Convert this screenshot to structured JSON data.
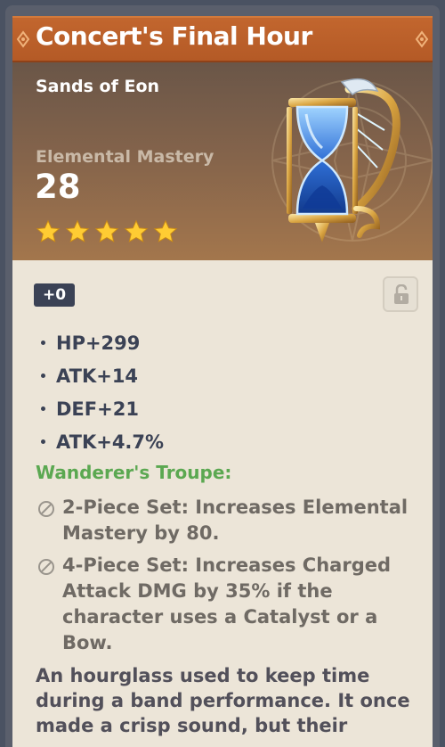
{
  "artifact": {
    "name": "Concert's Final Hour",
    "slot": "Sands of Eon",
    "main_stat": {
      "name": "Elemental Mastery",
      "value": "28"
    },
    "rarity": 5,
    "level": "+0",
    "locked": false,
    "substats": [
      "HP+299",
      "ATK+14",
      "DEF+21",
      "ATK+4.7%"
    ],
    "set": {
      "name": "Wanderer's Troupe:",
      "effects": [
        "2-Piece Set: Increases Elemental Mastery by 80.",
        "4-Piece Set: Increases Charged Attack DMG by 35% if the character uses a Catalyst or a Bow."
      ]
    },
    "description": "An hourglass used to keep time during a band performance. It once made a crisp sound, but their"
  },
  "icons": {
    "star": "star-icon",
    "lock": "lock-icon",
    "set_inactive": "ban-icon",
    "artwork": "hourglass-artifact-icon"
  },
  "colors": {
    "title_bar": "#bc5f2a",
    "header_bottom": "#a3764c",
    "body_bg": "#ece5d8",
    "star": "#ffcc33",
    "set_name": "#5ba851",
    "text_dark": "#3b4255",
    "text_muted": "#6f6a64"
  }
}
